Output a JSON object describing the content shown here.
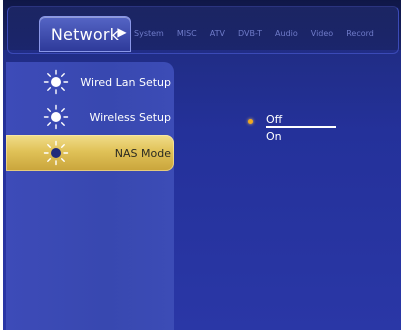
{
  "header": {
    "active_tab": "Network",
    "tabs": [
      "System",
      "MISC",
      "ATV",
      "DVB-T",
      "Audio",
      "Video",
      "Record"
    ]
  },
  "sidebar": {
    "items": [
      {
        "label": "Wired Lan Setup",
        "icon": "sun-icon",
        "selected": false
      },
      {
        "label": "Wireless Setup",
        "icon": "sun-icon",
        "selected": false
      },
      {
        "label": "NAS Mode",
        "icon": "sun-icon",
        "selected": true
      }
    ]
  },
  "options": {
    "items": [
      "Off",
      "On"
    ],
    "selected": "Off"
  },
  "colors": {
    "background": "#2a37a6",
    "highlight": "#e0c258",
    "bullet": "#f0a820"
  }
}
